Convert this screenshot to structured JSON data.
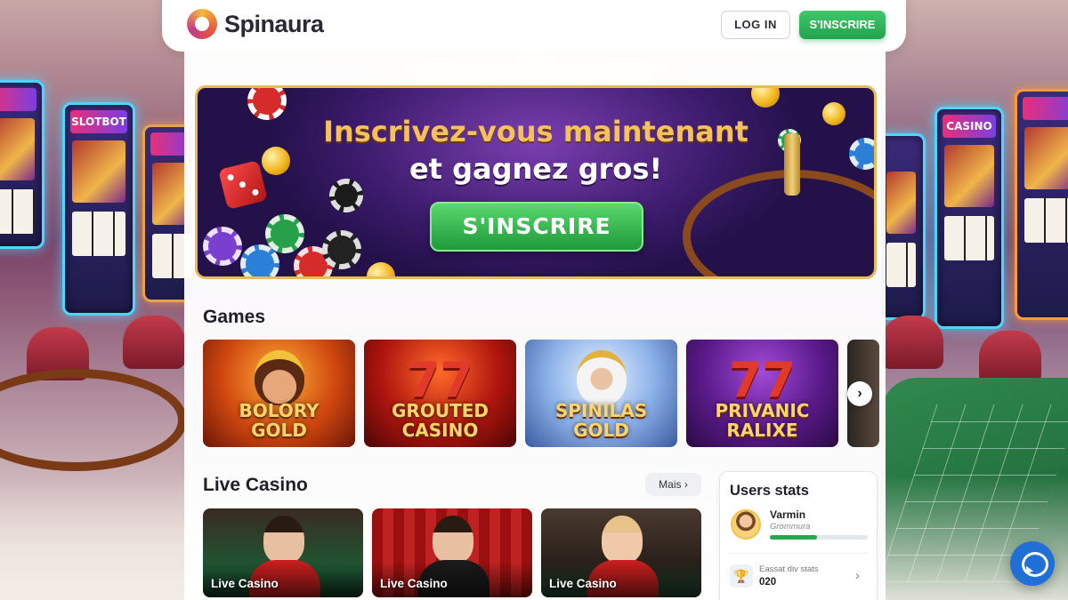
{
  "brand": {
    "name": "Spinaura"
  },
  "header": {
    "login_label": "LOG IN",
    "signup_label": "S'INSCRIRE"
  },
  "hero": {
    "title_line1": "Inscrivez-vous maintenant",
    "title_line2": "et gagnez gros!",
    "cta_label": "S'INSCRIRE"
  },
  "games": {
    "title": "Games",
    "items": [
      {
        "name": "BOLORY GOLD"
      },
      {
        "name": "GROUTED CASINO"
      },
      {
        "name": "SPINILAS GOLD"
      },
      {
        "name": "PRIVANIC RALIXE"
      }
    ],
    "next_icon": "chevron-right-icon"
  },
  "live_casino": {
    "title": "Live Casino",
    "more_label": "Mais",
    "items": [
      {
        "label": "Live Casino"
      },
      {
        "label": "Live Casino"
      },
      {
        "label": "Live Casino"
      }
    ]
  },
  "users_stats": {
    "title": "Users stats",
    "user_name": "Varmin",
    "user_sub": "Grommura",
    "progress": 0.48,
    "row_label": "Eassat div stats",
    "row_value": "020"
  },
  "background_signs": [
    "SLOTBOT",
    "CASINO"
  ],
  "colors": {
    "accent_green": "#23a24d",
    "hero_gold": "#f6c15a",
    "chat_blue": "#1f6fd6"
  }
}
